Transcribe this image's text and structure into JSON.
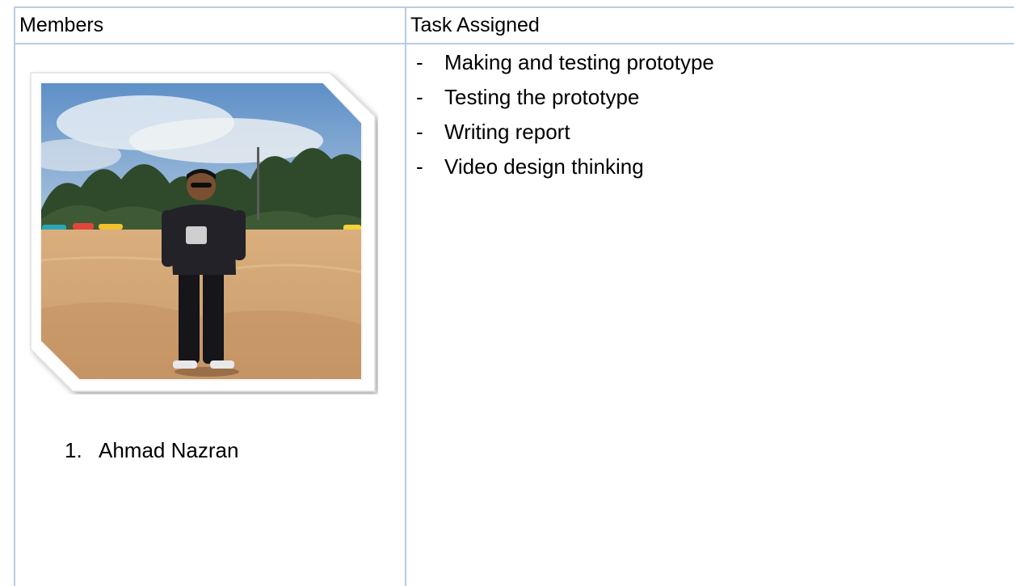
{
  "table": {
    "headers": [
      "Members",
      "Task Assigned"
    ],
    "members": [
      {
        "number": "1.",
        "name": "Ahmad Nazran",
        "photo_icon": "member-photo"
      }
    ],
    "tasks": [
      "Making and testing prototype",
      "Testing the prototype",
      "Writing report",
      "Video design thinking"
    ],
    "bullet": "-"
  },
  "colors": {
    "border": "#b8cce4",
    "text": "#000000"
  }
}
